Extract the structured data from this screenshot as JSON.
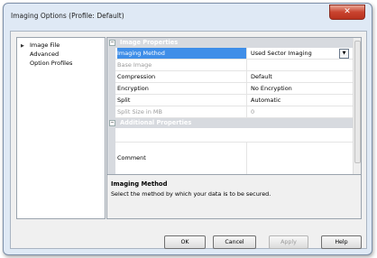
{
  "window": {
    "title": "Imaging Options (Profile: Default)",
    "close_glyph": "✕"
  },
  "tree": {
    "items": [
      {
        "label": "Image File",
        "expanded_icon": "▶"
      },
      {
        "label": "Advanced"
      },
      {
        "label": "Option Profiles"
      }
    ]
  },
  "grid": {
    "categories": [
      {
        "label": "Image Properties",
        "toggle": "−"
      },
      {
        "label": "Additional Properties",
        "toggle": "−"
      }
    ],
    "properties": [
      {
        "name": "Imaging Method",
        "value": "Used Sector Imaging",
        "dropdown_glyph": "▼"
      },
      {
        "name": "Base Image",
        "value": ""
      },
      {
        "name": "Compression",
        "value": "Default"
      },
      {
        "name": "Encryption",
        "value": "No Encryption"
      },
      {
        "name": "Split",
        "value": "Automatic"
      },
      {
        "name": "Split Size in MB",
        "value": "0"
      }
    ],
    "comment": {
      "name": "Comment",
      "value": ""
    }
  },
  "description": {
    "title": "Imaging Method",
    "text": "Select the method by which your data is to be secured."
  },
  "buttons": {
    "ok": "OK",
    "cancel": "Cancel",
    "apply": "Apply",
    "help": "Help"
  }
}
